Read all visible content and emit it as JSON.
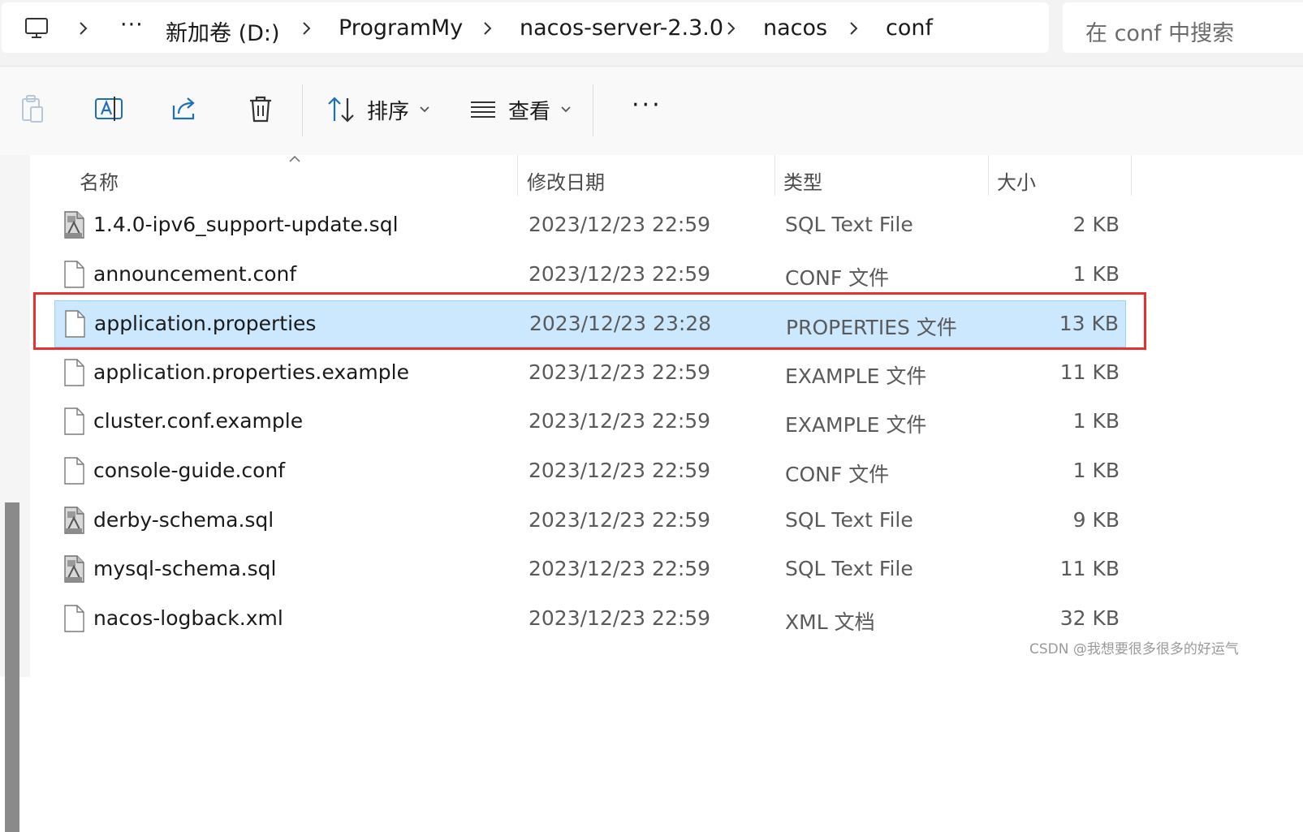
{
  "address_bar": {
    "breadcrumbs": [
      "新加卷 (D:)",
      "ProgramMy",
      "nacos-server-2.3.0",
      "nacos",
      "conf"
    ],
    "overflow_label": "···",
    "search_placeholder": "在 conf 中搜索"
  },
  "toolbar": {
    "sort_label": "排序",
    "view_label": "查看",
    "more_label": "···",
    "icons": [
      "paste-icon",
      "rename-icon",
      "share-icon",
      "delete-icon",
      "sort-icon",
      "view-icon"
    ]
  },
  "columns": {
    "name": "名称",
    "date": "修改日期",
    "type": "类型",
    "size": "大小"
  },
  "files": [
    {
      "name": "1.4.0-ipv6_support-update.sql",
      "date": "2023/12/23 22:59",
      "type": "SQL Text File",
      "size": "2 KB",
      "icon": "sql-file-icon"
    },
    {
      "name": "announcement.conf",
      "date": "2023/12/23 22:59",
      "type": "CONF 文件",
      "size": "1 KB",
      "icon": "file-icon"
    },
    {
      "name": "application.properties",
      "date": "2023/12/23 23:28",
      "type": "PROPERTIES 文件",
      "size": "13 KB",
      "icon": "file-icon",
      "selected": true
    },
    {
      "name": "application.properties.example",
      "date": "2023/12/23 22:59",
      "type": "EXAMPLE 文件",
      "size": "11 KB",
      "icon": "file-icon"
    },
    {
      "name": "cluster.conf.example",
      "date": "2023/12/23 22:59",
      "type": "EXAMPLE 文件",
      "size": "1 KB",
      "icon": "file-icon"
    },
    {
      "name": "console-guide.conf",
      "date": "2023/12/23 22:59",
      "type": "CONF 文件",
      "size": "1 KB",
      "icon": "file-icon"
    },
    {
      "name": "derby-schema.sql",
      "date": "2023/12/23 22:59",
      "type": "SQL Text File",
      "size": "9 KB",
      "icon": "sql-file-icon"
    },
    {
      "name": "mysql-schema.sql",
      "date": "2023/12/23 22:59",
      "type": "SQL Text File",
      "size": "11 KB",
      "icon": "sql-file-icon"
    },
    {
      "name": "nacos-logback.xml",
      "date": "2023/12/23 22:59",
      "type": "XML 文档",
      "size": "32 KB",
      "icon": "file-icon"
    }
  ],
  "watermark": "CSDN @我想要很多很多的好运气",
  "colors": {
    "selection_bg": "#cce8ff",
    "selection_border": "#99d1ff",
    "highlight_box": "#e8312f",
    "share_icon": "#1a6fbf"
  }
}
